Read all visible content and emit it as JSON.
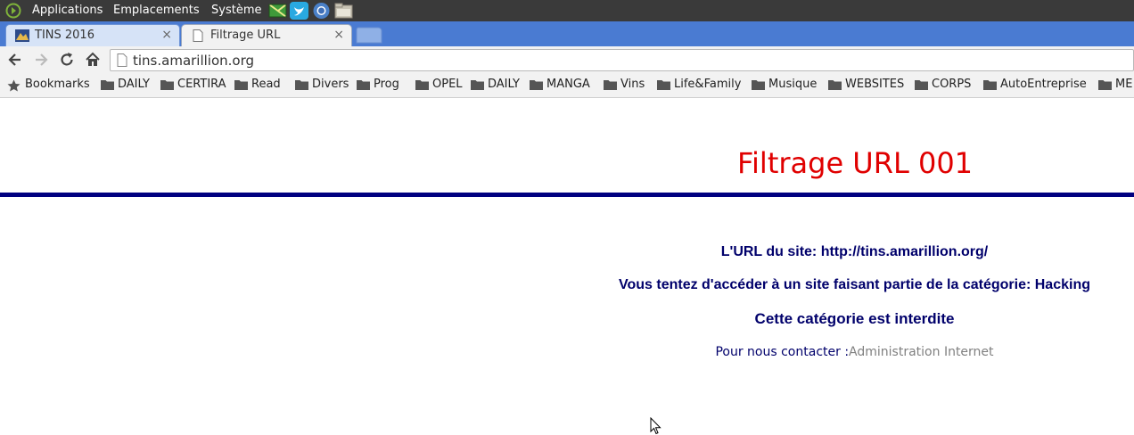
{
  "panel": {
    "menus": [
      "Applications",
      "Emplacements",
      "Système"
    ]
  },
  "tabs": [
    {
      "title": "TINS 2016",
      "active": false
    },
    {
      "title": "Filtrage URL",
      "active": true
    }
  ],
  "tab_close_glyph": "×",
  "address_bar": {
    "url": "tins.amarillion.org"
  },
  "bookmarks_label": "Bookmarks",
  "bookmark_folders": [
    "DAILY",
    "CERTIRA",
    "Read",
    "Divers",
    "Prog",
    "OPEL",
    "DAILY",
    "MANGA",
    "Vins",
    "Life&Family",
    "Musique",
    "WEBSITES",
    "CORPS",
    "AutoEntreprise",
    "ME"
  ],
  "page": {
    "heading": "Filtrage URL 001",
    "site_url_line": "L'URL du site: http://tins.amarillion.org/",
    "category_line": "Vous tentez d'accéder à un site faisant partie de la catégorie: Hacking",
    "forbidden_line": "Cette catégorie est interdite",
    "contact_label": "Pour nous contacter :",
    "contact_link": "Administration Internet"
  },
  "colors": {
    "heading": "#e00000",
    "rule": "#000080",
    "message_text": "#00006b",
    "contact_link": "#808080",
    "tabstrip": "#4a7bd2",
    "panel": "#3a3a3a"
  },
  "icons": [
    "distro-logo-icon",
    "map-launcher-icon",
    "twitter-launcher-icon",
    "chromium-launcher-icon",
    "file-manager-launcher-icon",
    "back-arrow-icon",
    "forward-arrow-icon",
    "reload-icon",
    "home-icon",
    "page-icon",
    "star-icon",
    "folder-icon",
    "mouse-cursor-icon"
  ]
}
